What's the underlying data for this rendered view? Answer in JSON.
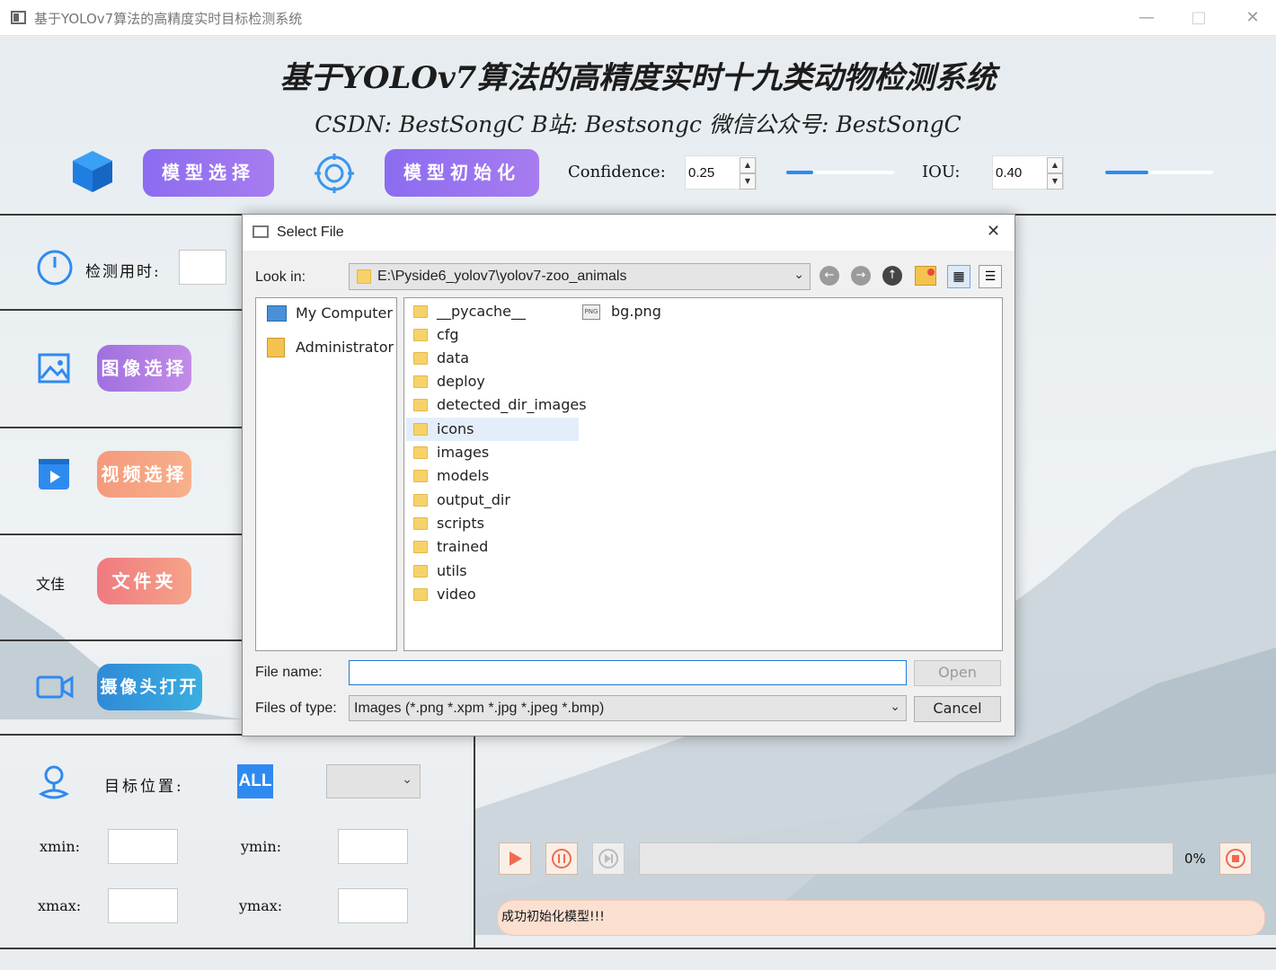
{
  "window": {
    "title": "基于YOLOv7算法的高精度实时目标检测系统",
    "minimize": "—",
    "maximize": "□",
    "close": "✕"
  },
  "header": {
    "title": "基于YOLOv7算法的高精度实时十九类动物检测系统",
    "subtitle": "CSDN:  BestSongC    B站:  Bestsongc    微信公众号:  BestSongC",
    "model_select": "模型选择",
    "model_init": "模型初始化",
    "confidence_label": "Confidence:",
    "confidence_value": "0.25",
    "confidence_slider": 0.25,
    "iou_label": "IOU:",
    "iou_value": "0.40",
    "iou_slider": 0.4
  },
  "sidebar": {
    "detect_time_label": "检测用时:",
    "image_select": "图像选择",
    "video_select": "视频选择",
    "folder_icon_text": "文佳",
    "folder": "文件夹",
    "camera_open": "摄像头打开"
  },
  "target": {
    "label": "目标位置:",
    "all_badge": "ALL",
    "select_value": "",
    "xmin": "xmin:",
    "ymin": "ymin:",
    "xmax": "xmax:",
    "ymax": "ymax:"
  },
  "player": {
    "progress": "0%",
    "progress_value": 0,
    "status": "成功初始化模型!!!"
  },
  "dialog": {
    "title": "Select File",
    "close": "✕",
    "look_in_label": "Look in:",
    "look_in_value": "E:\\Pyside6_yolov7\\yolov7-zoo_animals",
    "places": [
      "My Computer",
      "Administrator"
    ],
    "folders": [
      "__pycache__",
      "cfg",
      "data",
      "deploy",
      "detected_dir_images",
      "icons",
      "images",
      "models",
      "output_dir",
      "scripts",
      "trained",
      "utils",
      "video"
    ],
    "selected": "icons",
    "file": "bg.png",
    "file_badge": "PNG",
    "file_name_label": "File name:",
    "file_name_value": "",
    "files_of_type_label": "Files of type:",
    "files_of_type_value": "Images (*.png *.xpm *.jpg *.jpeg *.bmp)",
    "open": "Open",
    "cancel": "Cancel"
  },
  "colors": {
    "accent_purple": "#8b6cf0",
    "slider_blue": "#2f8af0",
    "status_bg": "#fbdfd1"
  }
}
